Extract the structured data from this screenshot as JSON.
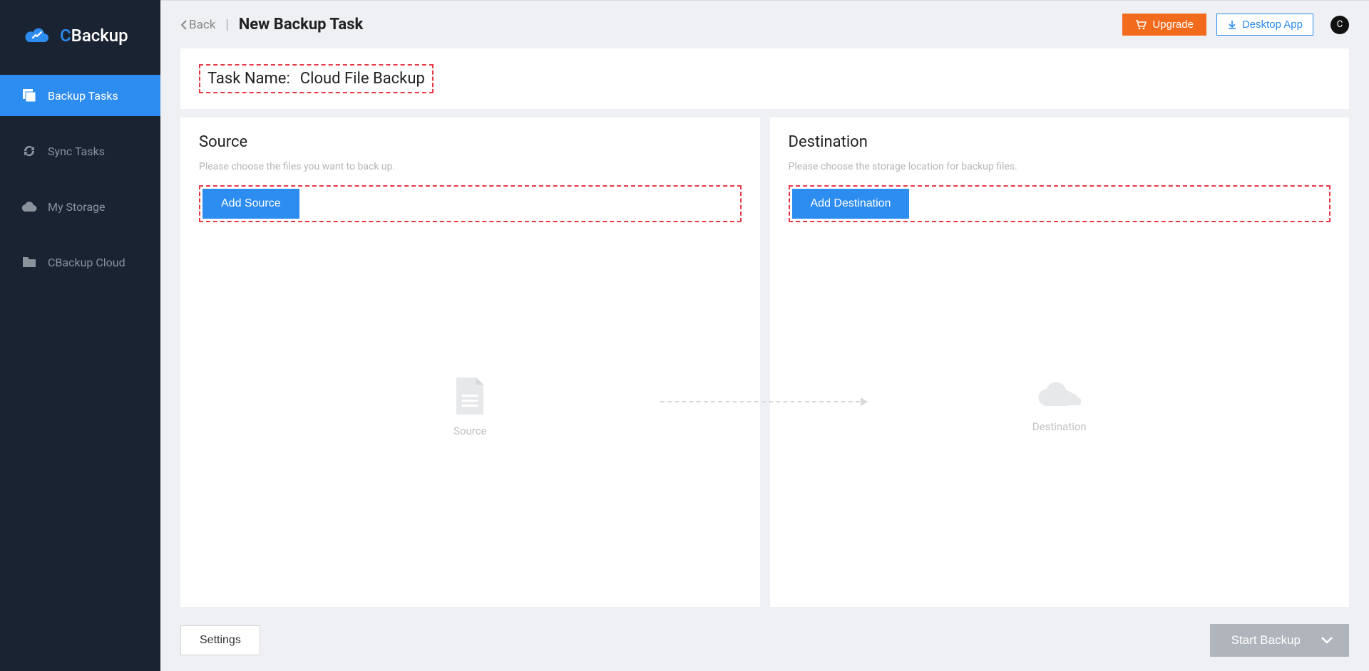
{
  "brand": {
    "name": "CBackup"
  },
  "sidebar": {
    "items": [
      {
        "label": "Backup Tasks",
        "icon": "stack-icon",
        "active": true
      },
      {
        "label": "Sync Tasks",
        "icon": "sync-icon",
        "active": false
      },
      {
        "label": "My Storage",
        "icon": "cloud-icon",
        "active": false
      },
      {
        "label": "CBackup Cloud",
        "icon": "folder-icon",
        "active": false
      }
    ]
  },
  "topbar": {
    "back_label": "Back",
    "page_title": "New Backup Task",
    "upgrade_label": "Upgrade",
    "desktop_label": "Desktop App",
    "avatar_initial": "C"
  },
  "task": {
    "name_label": "Task Name:",
    "name_value": "Cloud File Backup"
  },
  "source": {
    "title": "Source",
    "hint": "Please choose the files you want to back up.",
    "add_label": "Add Source",
    "placeholder_label": "Source"
  },
  "destination": {
    "title": "Destination",
    "hint": "Please choose the storage location for backup files.",
    "add_label": "Add Destination",
    "placeholder_label": "Destination"
  },
  "footer": {
    "settings_label": "Settings",
    "start_label": "Start Backup"
  }
}
